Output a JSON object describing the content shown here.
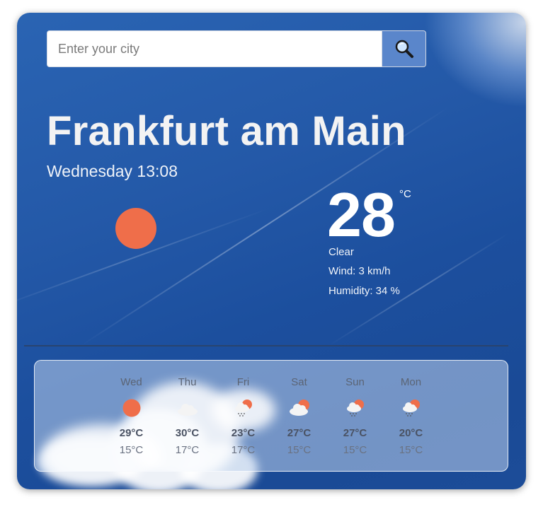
{
  "search": {
    "placeholder": "Enter your city",
    "button_icon": "search-icon"
  },
  "current": {
    "city": "Frankfurt am Main",
    "datetime": "Wednesday 13:08",
    "icon": "sun-icon",
    "temperature": "28",
    "unit": "°C",
    "condition": "Clear",
    "wind": "Wind: 3 km/h",
    "humidity": "Humidity: 34 %"
  },
  "forecast": {
    "days": [
      {
        "day": "Wed",
        "icon": "sun-icon",
        "high": "29°C",
        "low": "15°C"
      },
      {
        "day": "Thu",
        "icon": "cloud-icon",
        "high": "30°C",
        "low": "17°C"
      },
      {
        "day": "Fri",
        "icon": "sun-cloud-rain-icon",
        "high": "23°C",
        "low": "17°C"
      },
      {
        "day": "Sat",
        "icon": "sun-cloud-icon",
        "high": "27°C",
        "low": "15°C"
      },
      {
        "day": "Sun",
        "icon": "sun-cloud-rain-icon",
        "high": "27°C",
        "low": "15°C"
      },
      {
        "day": "Mon",
        "icon": "sun-cloud-rain-icon",
        "high": "20°C",
        "low": "15°C"
      }
    ]
  },
  "colors": {
    "sun": "#ef6e4a",
    "search_button": "#5a86cb",
    "sky": "#1e539f"
  }
}
